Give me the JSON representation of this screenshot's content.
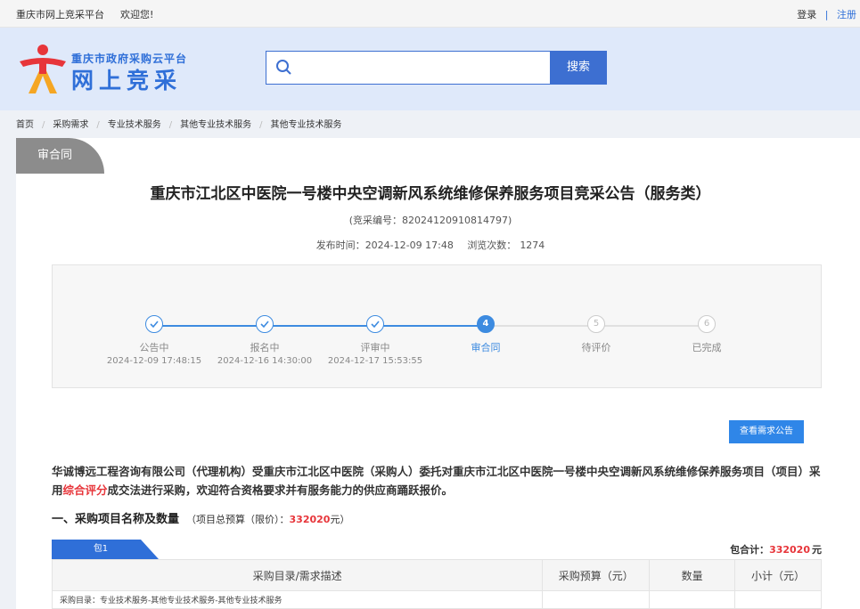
{
  "topbar": {
    "site_name": "重庆市网上竞采平台",
    "welcome": "欢迎您!",
    "login": "登录",
    "separator": "|",
    "register": "注册"
  },
  "header": {
    "logo_sub": "重庆市政府采购云平台",
    "logo_main": "网上竞采",
    "search_placeholder": "",
    "search_button": "搜索"
  },
  "breadcrumb": [
    "首页",
    "采购需求",
    "专业技术服务",
    "其他专业技术服务",
    "其他专业技术服务"
  ],
  "status_tab": "审合同",
  "notice": {
    "title": "重庆市江北区中医院一号楼中央空调新风系统维修保养服务项目竞采公告（服务类）",
    "code": "(竞采编号：82024120910814797)",
    "publish_label": "发布时间：",
    "publish_time": "2024-12-09 17:48",
    "views_label": "浏览次数：",
    "views": "1274"
  },
  "steps": [
    {
      "num": "1",
      "label": "公告中",
      "time": "2024-12-09 17:48:15",
      "state": "done"
    },
    {
      "num": "2",
      "label": "报名中",
      "time": "2024-12-16 14:30:00",
      "state": "done"
    },
    {
      "num": "3",
      "label": "评审中",
      "time": "2024-12-17 15:53:55",
      "state": "done"
    },
    {
      "num": "4",
      "label": "审合同",
      "time": "",
      "state": "current"
    },
    {
      "num": "5",
      "label": "待评价",
      "time": "",
      "state": "pending"
    },
    {
      "num": "6",
      "label": "已完成",
      "time": "",
      "state": "pending"
    }
  ],
  "view_request_button": "查看需求公告",
  "intro": {
    "before": "华诚博远工程咨询有限公司（代理机构）受重庆市江北区中医院（采购人）委托对重庆市江北区中医院一号楼中央空调新风系统维修保养服务项目（项目）采用",
    "highlight": "综合评分",
    "after": "成交法进行采购，欢迎符合资格要求并有服务能力的供应商踊跃报价。"
  },
  "section": {
    "title": "一、采购项目名称及数量",
    "budget_label": "（项目总预算（限价）：",
    "budget_value": "332020",
    "budget_unit": "元）"
  },
  "package": {
    "tab_label": "包1",
    "total_label": "包合计：",
    "total_value": "332020",
    "total_unit": "元"
  },
  "table": {
    "headers": [
      "采购目录/需求描述",
      "采购预算（元）",
      "数量",
      "小计（元）"
    ],
    "rows": [
      [
        "采购目录：专业技术服务-其他专业技术服务-其他专业技术服务",
        "",
        "",
        ""
      ]
    ]
  },
  "colors": {
    "primary": "#3d6fd1",
    "step_blue": "#3d8be0",
    "highlight_red": "#e7353a",
    "header_bg": "#dfe9fa"
  }
}
